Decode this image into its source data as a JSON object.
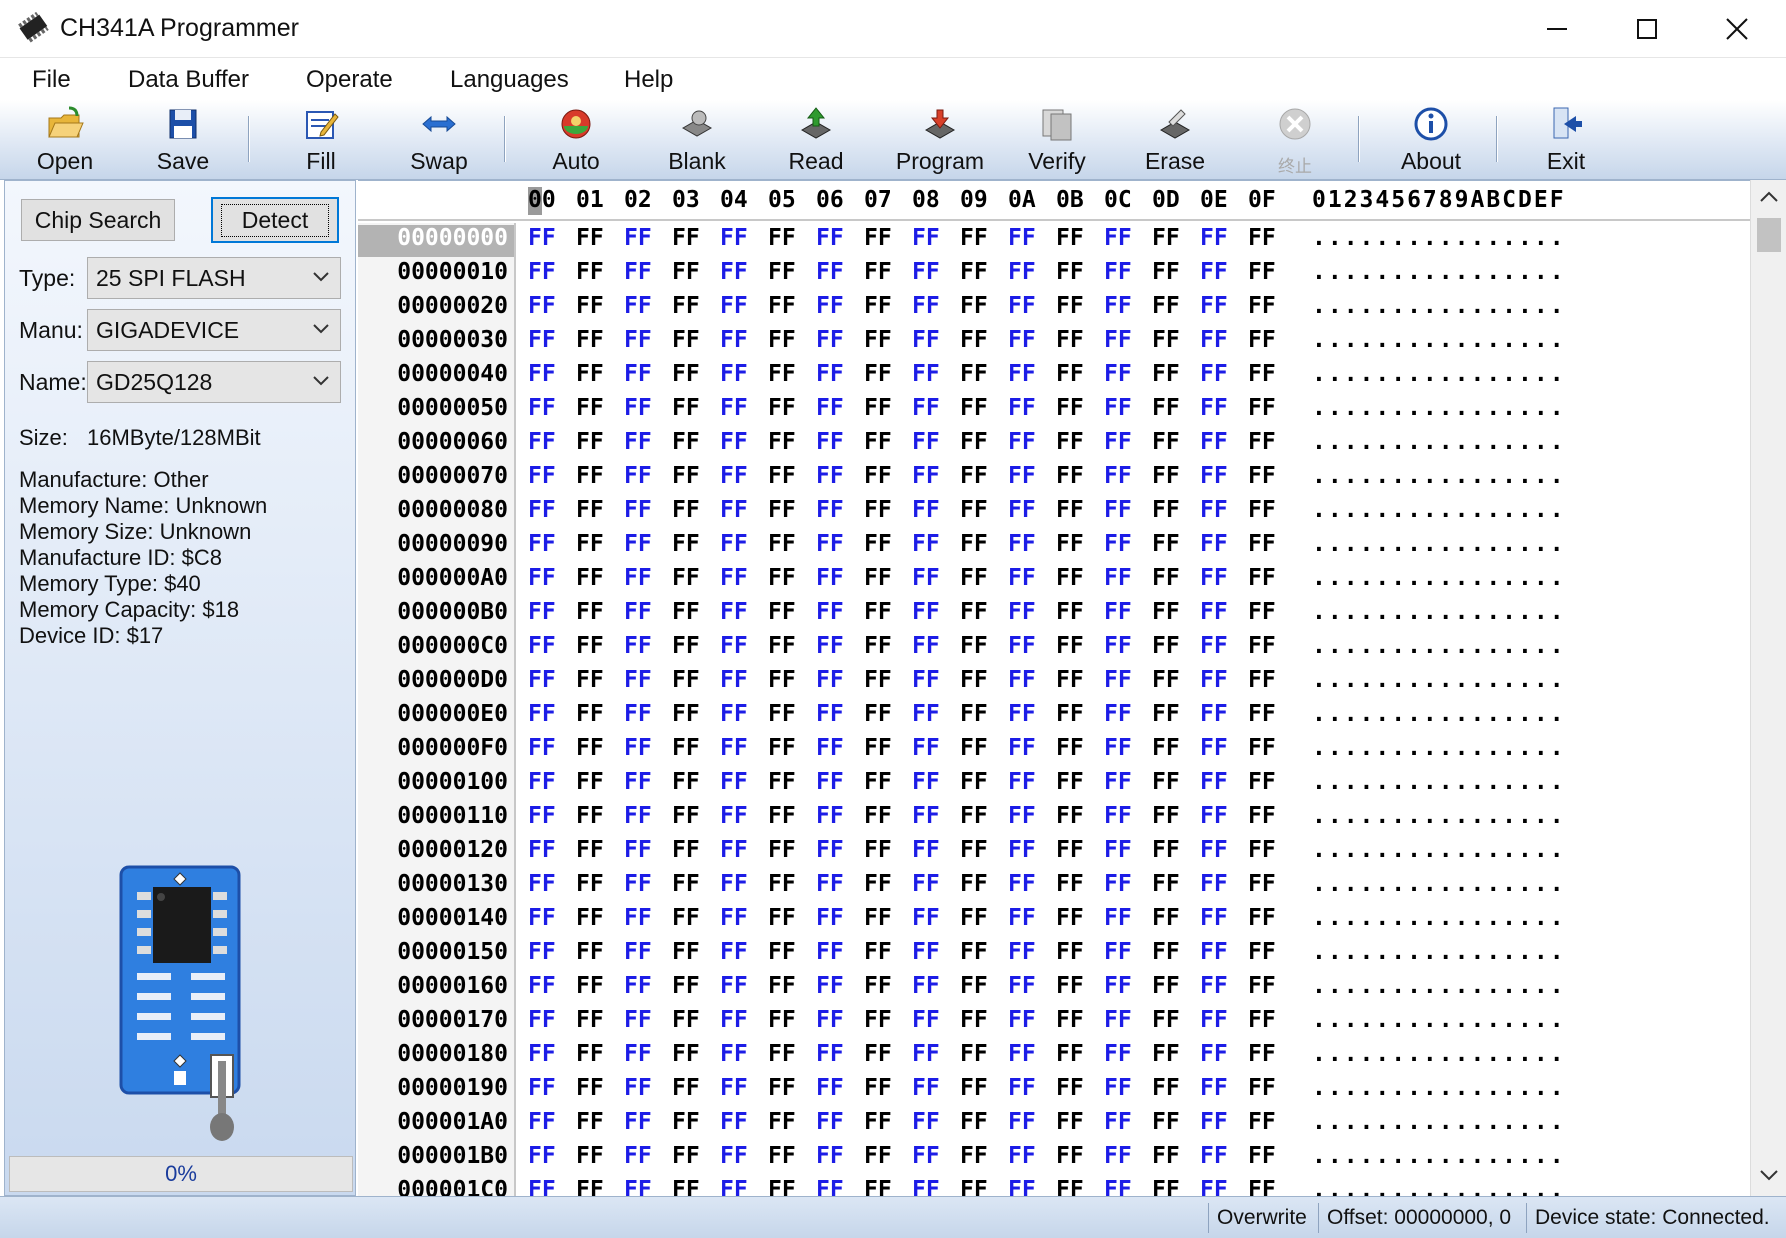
{
  "window": {
    "title": "CH341A Programmer"
  },
  "menu": [
    "File",
    "Data Buffer",
    "Operate",
    "Languages",
    "Help"
  ],
  "toolbar": {
    "open": "Open",
    "save": "Save",
    "fill": "Fill",
    "swap": "Swap",
    "auto": "Auto",
    "blank": "Blank",
    "read": "Read",
    "program": "Program",
    "verify": "Verify",
    "erase": "Erase",
    "stop": "终止",
    "about": "About",
    "exit": "Exit"
  },
  "left": {
    "chip_search": "Chip Search",
    "detect": "Detect",
    "type_label": "Type:",
    "type_value": "25 SPI FLASH",
    "manu_label": "Manu:",
    "manu_value": "GIGADEVICE",
    "name_label": "Name:",
    "name_value": "GD25Q128",
    "size_label": "Size:",
    "size_value": "16MByte/128MBit",
    "info": [
      "Manufacture: Other",
      "Memory Name: Unknown",
      "Memory Size: Unknown",
      "Manufacture ID: $C8",
      "Memory Type: $40",
      "Memory Capacity: $18",
      "Device ID: $17"
    ],
    "progress": "0%"
  },
  "hex": {
    "columns": [
      "00",
      "01",
      "02",
      "03",
      "04",
      "05",
      "06",
      "07",
      "08",
      "09",
      "0A",
      "0B",
      "0C",
      "0D",
      "0E",
      "0F"
    ],
    "ascii_header": "0123456789ABCDEF",
    "fill_byte": "FF",
    "ascii_row": "................",
    "rows": [
      "00000000",
      "00000010",
      "00000020",
      "00000030",
      "00000040",
      "00000050",
      "00000060",
      "00000070",
      "00000080",
      "00000090",
      "000000A0",
      "000000B0",
      "000000C0",
      "000000D0",
      "000000E0",
      "000000F0",
      "00000100",
      "00000110",
      "00000120",
      "00000130",
      "00000140",
      "00000150",
      "00000160",
      "00000170",
      "00000180",
      "00000190",
      "000001A0",
      "000001B0",
      "000001C0"
    ]
  },
  "status": {
    "mode": "Overwrite",
    "offset": "Offset: 00000000, 0",
    "device": "Device state: Connected."
  }
}
